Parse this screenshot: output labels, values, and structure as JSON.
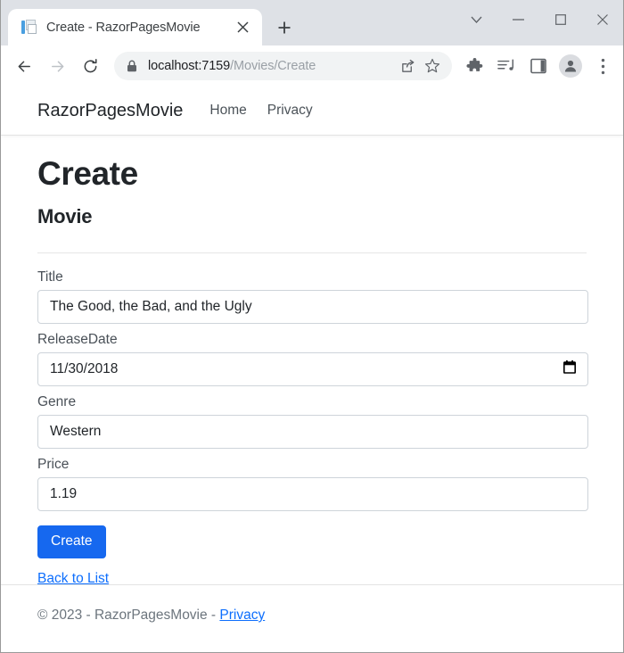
{
  "browser": {
    "tab": {
      "title": "Create - RazorPagesMovie",
      "favicon": "document-pages-icon",
      "close_icon": "close-icon"
    },
    "new_tab_icon": "plus-icon",
    "window_controls": {
      "tab_search_icon": "chevron-down-icon",
      "minimize_icon": "minimize-icon",
      "maximize_icon": "maximize-icon",
      "close_icon": "close-icon"
    },
    "toolbar": {
      "back_icon": "arrow-left-icon",
      "forward_icon": "arrow-right-icon",
      "reload_icon": "reload-icon",
      "security_icon": "lock-icon",
      "url_host": "localhost:7159",
      "url_path": "/Movies/Create",
      "share_icon": "share-icon",
      "bookmark_icon": "star-icon",
      "extensions_icon": "puzzle-piece-icon",
      "media_icon": "music-list-icon",
      "sidepanel_icon": "side-panel-icon",
      "profile_icon": "user-avatar-icon",
      "menu_icon": "three-dots-vertical-icon"
    }
  },
  "site": {
    "brand": "RazorPagesMovie",
    "nav": [
      {
        "label": "Home"
      },
      {
        "label": "Privacy"
      }
    ]
  },
  "main": {
    "title": "Create",
    "subtitle": "Movie",
    "fields": [
      {
        "label": "Title",
        "value": "The Good, the Bad, and the Ugly",
        "type": "text",
        "name": "title"
      },
      {
        "label": "ReleaseDate",
        "value": "11/30/2018",
        "type": "date",
        "name": "releasedate"
      },
      {
        "label": "Genre",
        "value": "Western",
        "type": "text",
        "name": "genre"
      },
      {
        "label": "Price",
        "value": "1.19",
        "type": "text",
        "name": "price"
      }
    ],
    "submit_label": "Create",
    "back_link_label": "Back to List",
    "date_picker_icon": "calendar-icon",
    "accent_color": "#1668ef",
    "link_color": "#0d6efd"
  },
  "footer": {
    "copyright": "© 2023 - RazorPagesMovie - ",
    "privacy_label": "Privacy"
  }
}
